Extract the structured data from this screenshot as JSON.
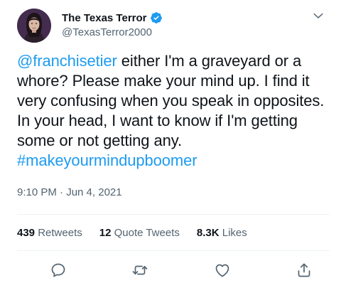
{
  "author": {
    "display_name": "The Texas Terror",
    "handle": "@TexasTerror2000",
    "verified": true,
    "avatar_icon": "user-avatar"
  },
  "tweet": {
    "mention": "@franchisetier",
    "body": " either I'm a graveyard or a whore? Please make your mind up. I find it very confusing when you speak in opposites. In your head, I want to know if I'm getting some or not getting any. ",
    "hashtag": "#makeyourmindupboomer",
    "timestamp": "9:10 PM · Jun 4, 2021"
  },
  "stats": {
    "retweets_count": "439",
    "retweets_label": "Retweets",
    "quote_count": "12",
    "quote_label": "Quote Tweets",
    "likes_count": "8.3K",
    "likes_label": "Likes"
  },
  "actions": [
    "reply-icon",
    "retweet-icon",
    "like-icon",
    "share-icon"
  ],
  "colors": {
    "link": "#1d9bf0",
    "verified": "#1d9bf0",
    "secondary_text": "#536471",
    "divider": "#eff3f4"
  }
}
